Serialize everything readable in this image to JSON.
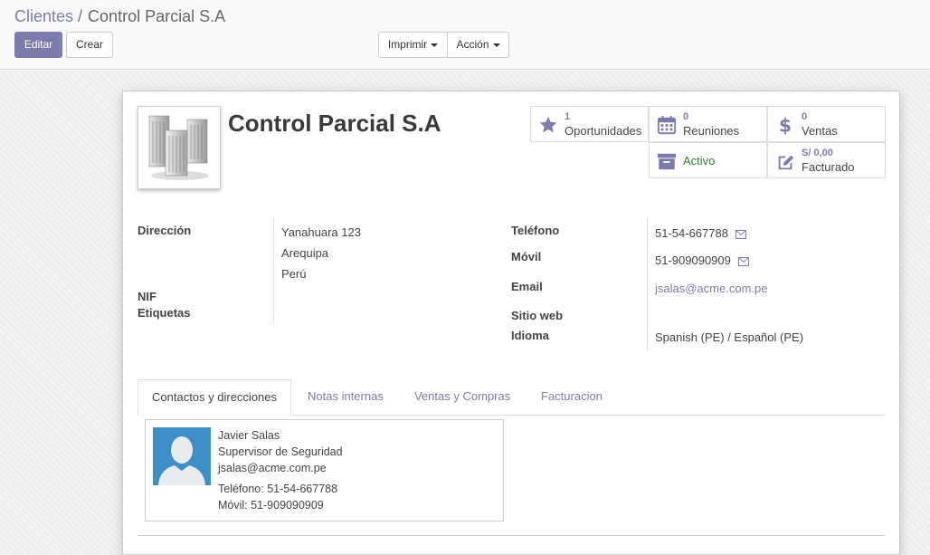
{
  "breadcrumb": {
    "parent": "Clientes",
    "separator": "/",
    "current": "Control Parcial S.A"
  },
  "toolbar": {
    "edit_label": "Editar",
    "create_label": "Crear",
    "print_label": "Imprimir",
    "action_label": "Acción"
  },
  "partner": {
    "name": "Control Parcial S.A"
  },
  "smart_buttons": {
    "opportunities": {
      "count": "1",
      "label": "Oportunidades",
      "icon": "star-icon"
    },
    "meetings": {
      "count": "0",
      "label": "Reuniones",
      "icon": "calendar-icon"
    },
    "sales": {
      "count": "0",
      "label": "Ventas",
      "icon": "dollar-icon"
    },
    "active": {
      "label": "Activo",
      "icon": "archive-icon"
    },
    "invoiced": {
      "amount": "S/ 0,00",
      "label": "Facturado",
      "icon": "pencil-square-icon"
    }
  },
  "fields": {
    "address_label": "Dirección",
    "address_lines": [
      "Yanahuara 123",
      "Arequipa",
      "Perú"
    ],
    "nif_label": "NIF",
    "tags_label": "Etiquetas",
    "phone_label": "Teléfono",
    "phone_value": "51-54-667788",
    "mobile_label": "Móvil",
    "mobile_value": "51-909090909",
    "email_label": "Email",
    "email_value": "jsalas@acme.com.pe",
    "website_label": "Sitio web",
    "lang_label": "Idioma",
    "lang_value": "Spanish (PE) / Español (PE)"
  },
  "tabs": [
    {
      "label": "Contactos y direcciones",
      "active": true
    },
    {
      "label": "Notas internas",
      "active": false
    },
    {
      "label": "Ventas y Compras",
      "active": false
    },
    {
      "label": "Facturacion",
      "active": false
    }
  ],
  "contact": {
    "name": "Javier Salas",
    "function": "Supervisor de Seguridad",
    "email": "jsalas@acme.com.pe",
    "phone": "Teléfono: 51-54-667788",
    "mobile": "Móvil: 51-909090909"
  },
  "colors": {
    "brand": "#7c7bad",
    "active_green": "#2e7d32"
  }
}
